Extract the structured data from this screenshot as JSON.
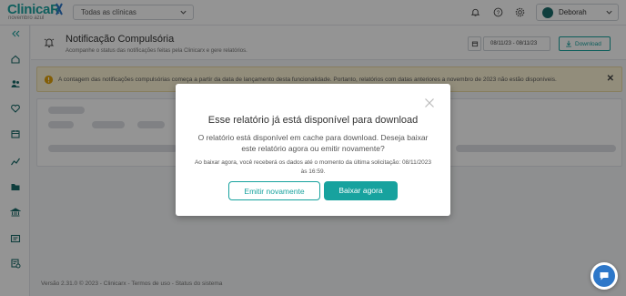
{
  "brand": {
    "name": "ClinicaR",
    "tagline": "novembro azul",
    "color": "#1aa3a0"
  },
  "topbar": {
    "clinic_select_value": "Todas as clínicas",
    "user_name": "Deborah",
    "icons": [
      "bell-icon",
      "help-icon",
      "gear-icon"
    ]
  },
  "sidebar": {
    "items": [
      "collapse-icon",
      "home-icon",
      "patients-icon",
      "heartbeat-icon",
      "calendar-icon",
      "reports-chart-icon",
      "folder-icon",
      "bank-icon",
      "id-card-icon",
      "schedule-list-icon"
    ]
  },
  "page": {
    "title": "Notificação Compulsória",
    "subtitle": "Acompanhe o status das notificações feitas pela Clinicarx e gere relatórios.",
    "date_range": "08/11/23 - 08/11/23",
    "download_label": "Download"
  },
  "warning": {
    "text": "A contagem das notificações compulsórias começa a partir da data de lançamento desta funcionalidade. Portanto, relatórios com datas anteriores a novembro de 2023 não estão disponíveis."
  },
  "footer": {
    "text": "Versão 2.31.0 ©  2023 - Clinicarx - Termos de uso - Status do sistema"
  },
  "modal": {
    "title": "Esse relatório já está disponível para download",
    "body": "O relatório está disponível em cache para download. Deseja baixar este relatório agora ou emitir novamente?",
    "note": "Ao baixar agora, você receberá os dados até o momento da última solicitação: 08/11/2023 às 16:59.",
    "secondary_label": "Emitir novamente",
    "primary_label": "Baixar agora"
  },
  "colors": {
    "accent": "#17a29e",
    "warning_bg": "#fbf3d5",
    "chat": "#2d77c9"
  }
}
